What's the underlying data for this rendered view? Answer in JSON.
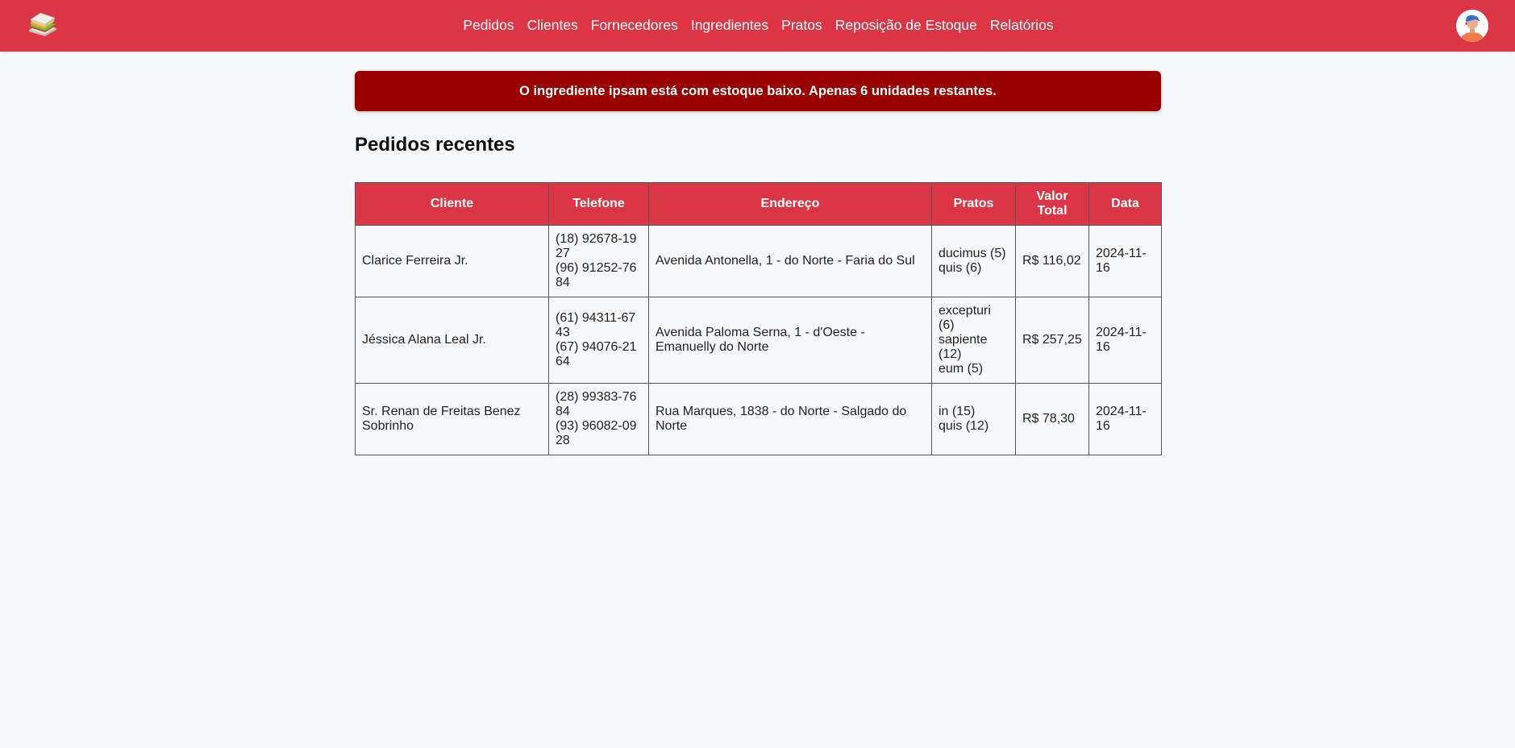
{
  "navbar": {
    "logo_icon": "sandwich-icon",
    "brand_color": "#dc3545",
    "links": [
      "Pedidos",
      "Clientes",
      "Fornecedores",
      "Ingredientes",
      "Pratos",
      "Reposição de Estoque",
      "Relatórios"
    ],
    "avatar_icon": "user-avatar-icon"
  },
  "alert": {
    "message": "O ingrediente ipsam está com estoque baixo. Apenas 6 unidades restantes.",
    "color": "#990000"
  },
  "page": {
    "title": "Pedidos recentes"
  },
  "table": {
    "headers": [
      "Cliente",
      "Telefone",
      "Endereço",
      "Pratos",
      "Valor Total",
      "Data"
    ],
    "rows": [
      {
        "cliente": "Clarice Ferreira Jr.",
        "telefones": [
          "(18) 92678-1927",
          "(96) 91252-7684"
        ],
        "endereco": "Avenida Antonella, 1 - do Norte - Faria do Sul",
        "pratos": [
          "ducimus (5)",
          "quis (6)"
        ],
        "valor_total": "R$ 116,02",
        "data": "2024-11-16"
      },
      {
        "cliente": "Jéssica Alana Leal Jr.",
        "telefones": [
          "(61) 94311-6743",
          "(67) 94076-2164"
        ],
        "endereco": "Avenida Paloma Serna, 1 - d'Oeste - Emanuelly do Norte",
        "pratos": [
          "excepturi (6)",
          "sapiente (12)",
          "eum (5)"
        ],
        "valor_total": "R$ 257,25",
        "data": "2024-11-16"
      },
      {
        "cliente": "Sr. Renan de Freitas Benez Sobrinho",
        "telefones": [
          "(28) 99383-7684",
          "(93) 96082-0928"
        ],
        "endereco": "Rua Marques, 1838 - do Norte - Salgado do Norte",
        "pratos": [
          "in (15)",
          "quis (12)"
        ],
        "valor_total": "R$ 78,30",
        "data": "2024-11-16"
      }
    ]
  }
}
